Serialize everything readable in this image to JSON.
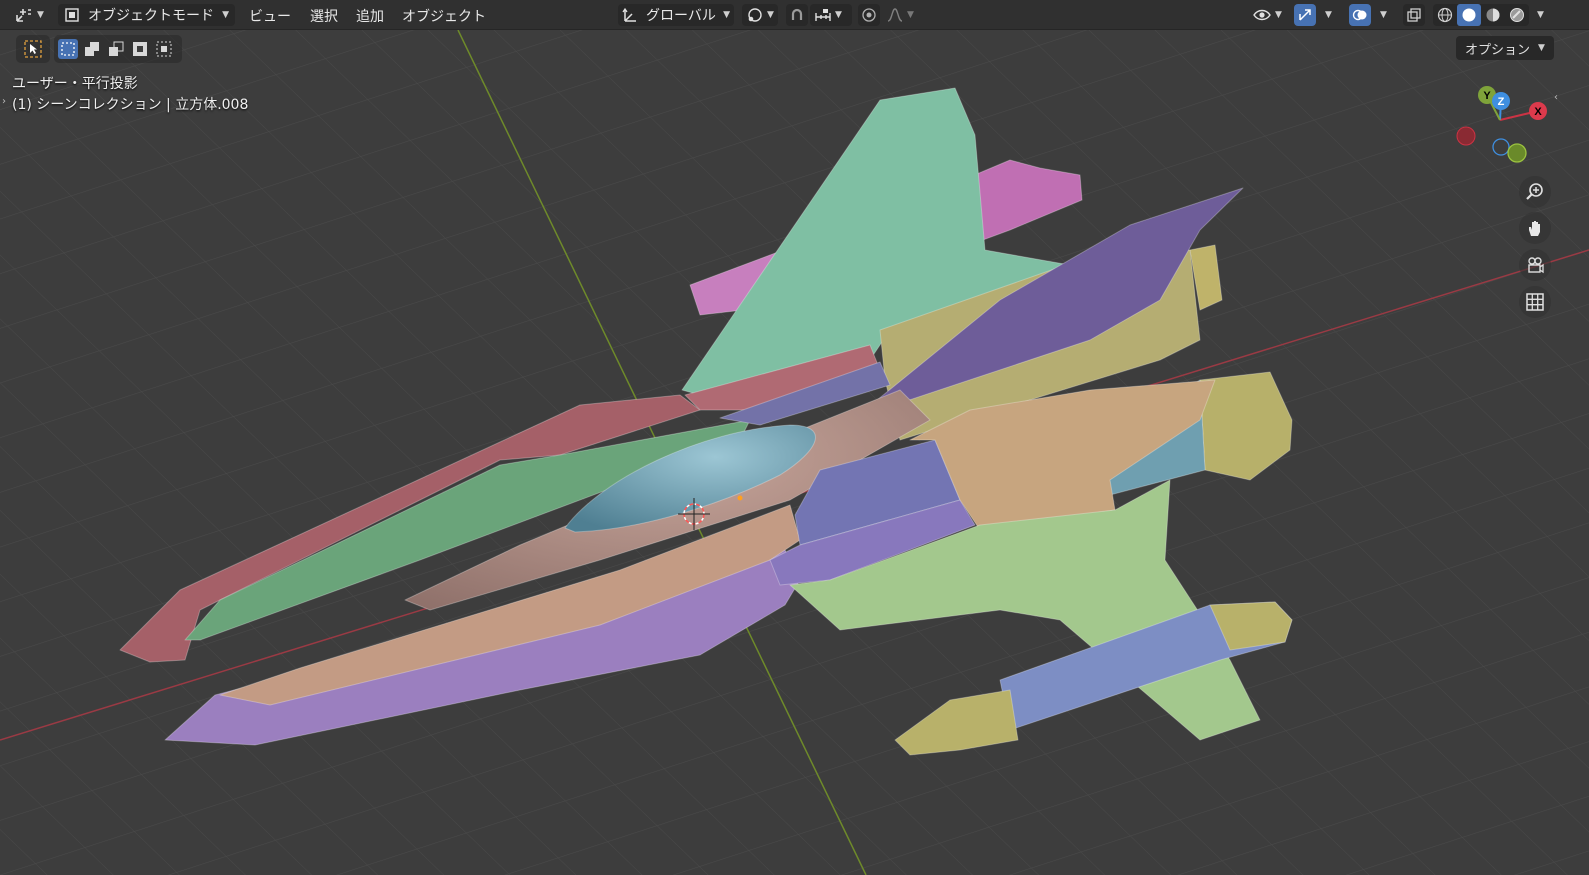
{
  "header": {
    "mode_label": "オブジェクトモード",
    "menus": [
      "ビュー",
      "選択",
      "追加",
      "オブジェクト"
    ],
    "orientation_label": "グローバル"
  },
  "viewport": {
    "projection_label": "ユーザー・平行投影",
    "collection_label": "(1) シーンコレクション | 立方体.008",
    "options_label": "オプション",
    "gizmo_axes": {
      "x": "X",
      "y": "Y",
      "z": "Z"
    }
  },
  "colors": {
    "accent": "#4772b3",
    "header_bg": "#303030",
    "viewport_bg": "#3d3d3d",
    "axis_x": "#cc3344",
    "axis_y": "#7fa33a",
    "axis_z": "#3f8fe0"
  },
  "icons": [
    "editor-type-icon",
    "object-mode-icon",
    "transform-orientation-icon",
    "pivot-icon",
    "snap-icon",
    "snap-increment-icon",
    "proportional-edit-icon",
    "falloff-icon",
    "visibility-icon",
    "gizmo-icon",
    "overlay-icon",
    "xray-icon",
    "wireframe-shading-icon",
    "solid-shading-icon",
    "material-shading-icon",
    "rendered-shading-icon",
    "select-tool-icon",
    "zoom-icon",
    "hand-icon",
    "camera-icon",
    "grid-icon"
  ]
}
